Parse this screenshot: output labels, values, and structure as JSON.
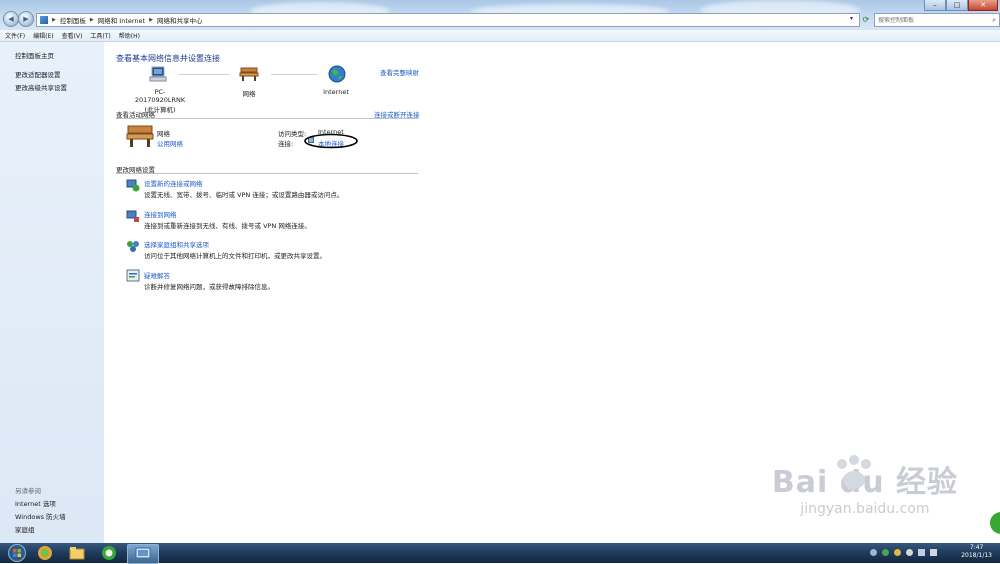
{
  "address_bar": {
    "crumbs": [
      "控制面板",
      "网络和 Internet",
      "网络和共享中心"
    ]
  },
  "search": {
    "placeholder": "搜索控制面板"
  },
  "menu": {
    "items": [
      "文件(F)",
      "编辑(E)",
      "查看(V)",
      "工具(T)",
      "帮助(H)"
    ]
  },
  "sidebar": {
    "top_links": [
      "控制面板主页",
      "更改适配器设置",
      "更改高级共享设置"
    ],
    "see_also_title": "另请参阅",
    "see_also_links": [
      "Internet 选项",
      "Windows 防火墙",
      "家庭组"
    ]
  },
  "main": {
    "title": "查看基本网络信息并设置连接",
    "view_full_map": "查看完整映射",
    "map_nodes": [
      {
        "label": "PC-20170920LRNK",
        "sublabel": "(此计算机)",
        "icon": "computer-icon"
      },
      {
        "label": "网络",
        "sublabel": "",
        "icon": "bench-network-icon"
      },
      {
        "label": "Internet",
        "sublabel": "",
        "icon": "globe-icon"
      }
    ],
    "active_networks_title": "查看活动网络",
    "connect_disconnect": "连接或断开连接",
    "network_name": "网络",
    "network_type": "公用网络",
    "access_type_label": "访问类型:",
    "access_type_value": "Internet",
    "connection_label": "连接:",
    "connection_value": "本地连接",
    "change_settings_title": "更改网络设置",
    "tasks": [
      {
        "title": "设置新的连接或网络",
        "desc": "设置无线、宽带、拨号、临时或 VPN 连接；或设置路由器或访问点。",
        "icon": "new-connection-icon"
      },
      {
        "title": "连接到网络",
        "desc": "连接到或重新连接到无线、有线、拨号或 VPN 网络连接。",
        "icon": "connect-network-icon"
      },
      {
        "title": "选择家庭组和共享选项",
        "desc": "访问位于其他网络计算机上的文件和打印机，或更改共享设置。",
        "icon": "homegroup-icon"
      },
      {
        "title": "疑难解答",
        "desc": "诊断并修复网络问题，或获得故障排除信息。",
        "icon": "troubleshoot-icon"
      }
    ]
  },
  "taskbar": {
    "time": "7:47",
    "date": "2018/1/13"
  },
  "watermark": {
    "brand": "Bai du 经验",
    "url": "jingyan.baidu.com"
  },
  "colors": {
    "link": "#1a5bc8",
    "title": "#1e3d8f",
    "taskbar": "#1f3a5a"
  }
}
